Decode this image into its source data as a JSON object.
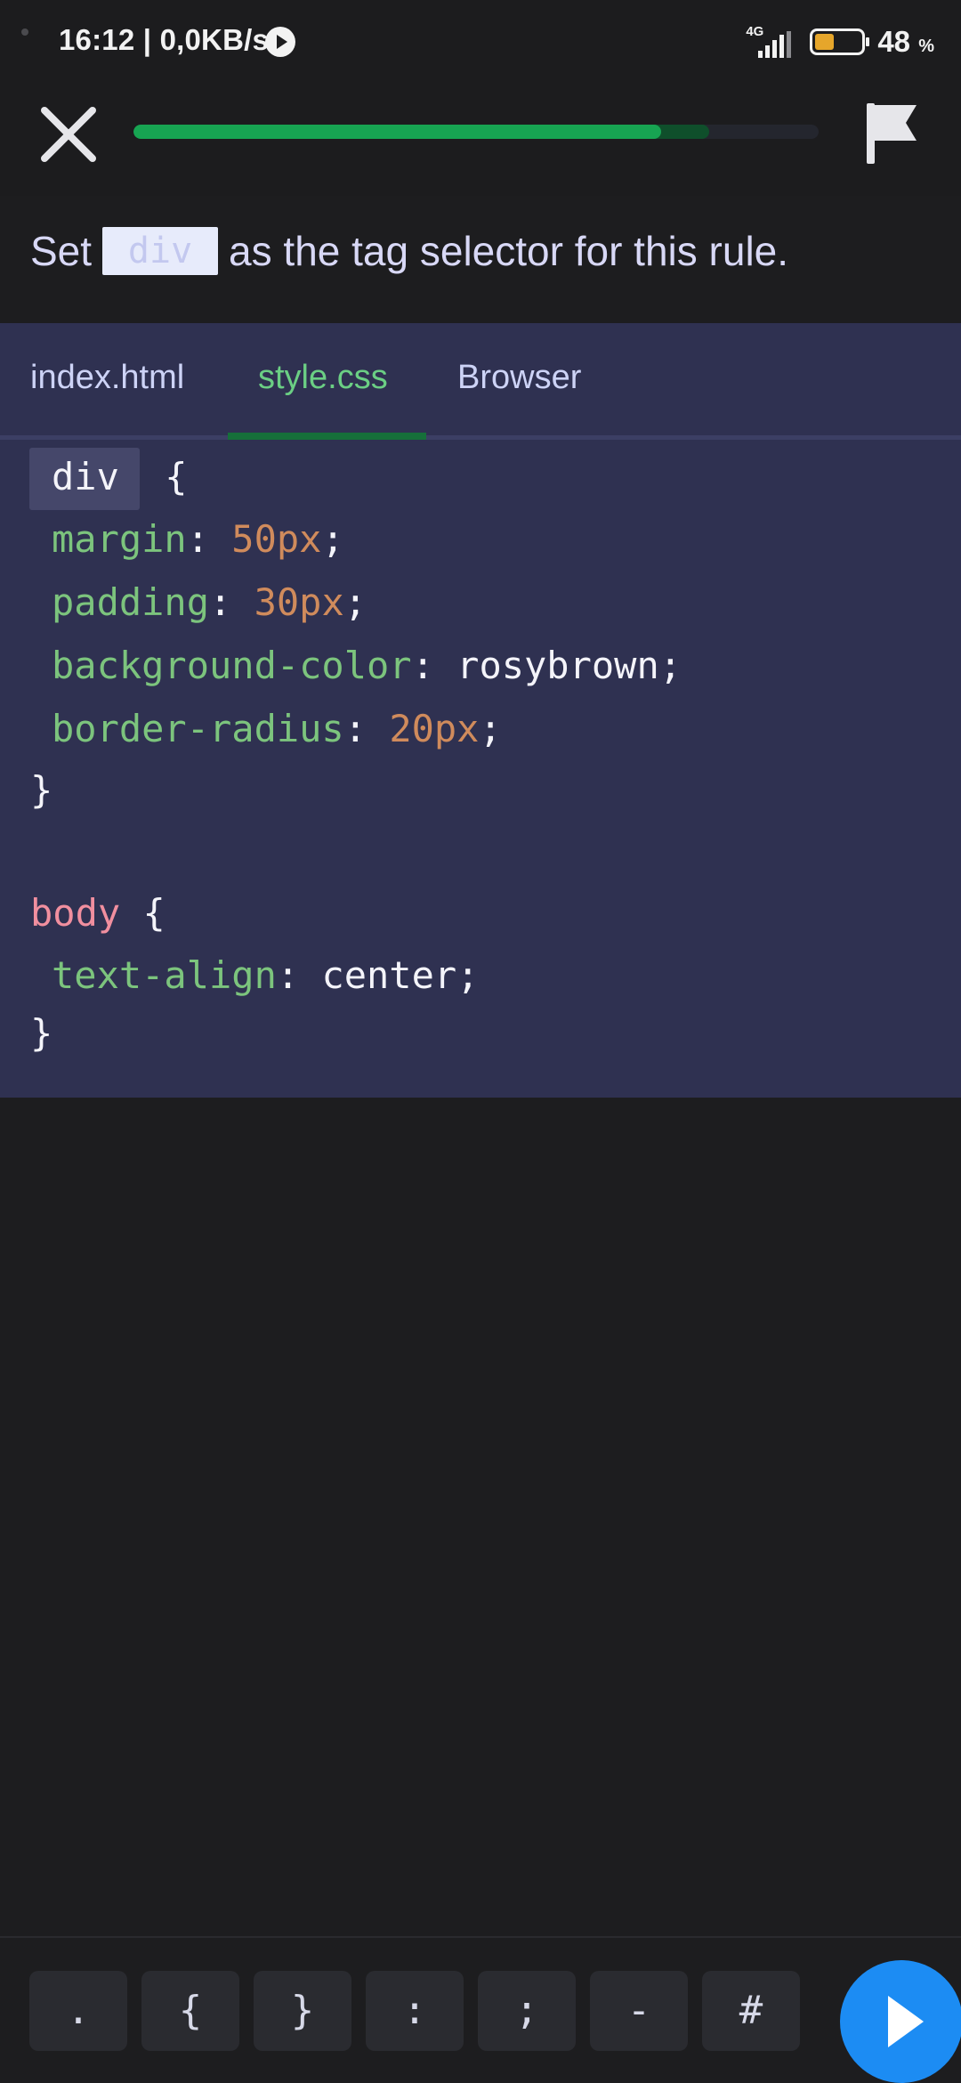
{
  "status_bar": {
    "time_speed": "16:12 | 0,0KB/s",
    "network": "4G",
    "battery_percent": "48",
    "battery_unit": "%",
    "battery_level": 0.48
  },
  "header": {
    "progress": 0.77,
    "progress_trail": 0.84
  },
  "instruction": {
    "prefix": "Set",
    "blank": "div",
    "suffix": "as the tag selector for this rule."
  },
  "tabs": [
    {
      "label": "index.html"
    },
    {
      "label": "style.css",
      "active": true
    },
    {
      "label": "Browser"
    }
  ],
  "code": {
    "selector1": "div",
    "open1": " {",
    "rules1": [
      {
        "prop": "margin",
        "value": "50px"
      },
      {
        "prop": "padding",
        "value": "30px"
      },
      {
        "prop": "background-color",
        "value": "rosybrown"
      },
      {
        "prop": "border-radius",
        "value": "20px"
      }
    ],
    "close1": "}",
    "selector2": "body",
    "open2": " {",
    "rules2": [
      {
        "prop": "text-align",
        "value": "center"
      }
    ],
    "close2": "}"
  },
  "keyboard": {
    "keys": [
      ".",
      "{",
      "}",
      ":",
      ";",
      "-",
      "#"
    ]
  },
  "colors": {
    "accent_green": "#17a452",
    "run_blue": "#1c8cf3",
    "panel_bg": "#2f3151"
  }
}
